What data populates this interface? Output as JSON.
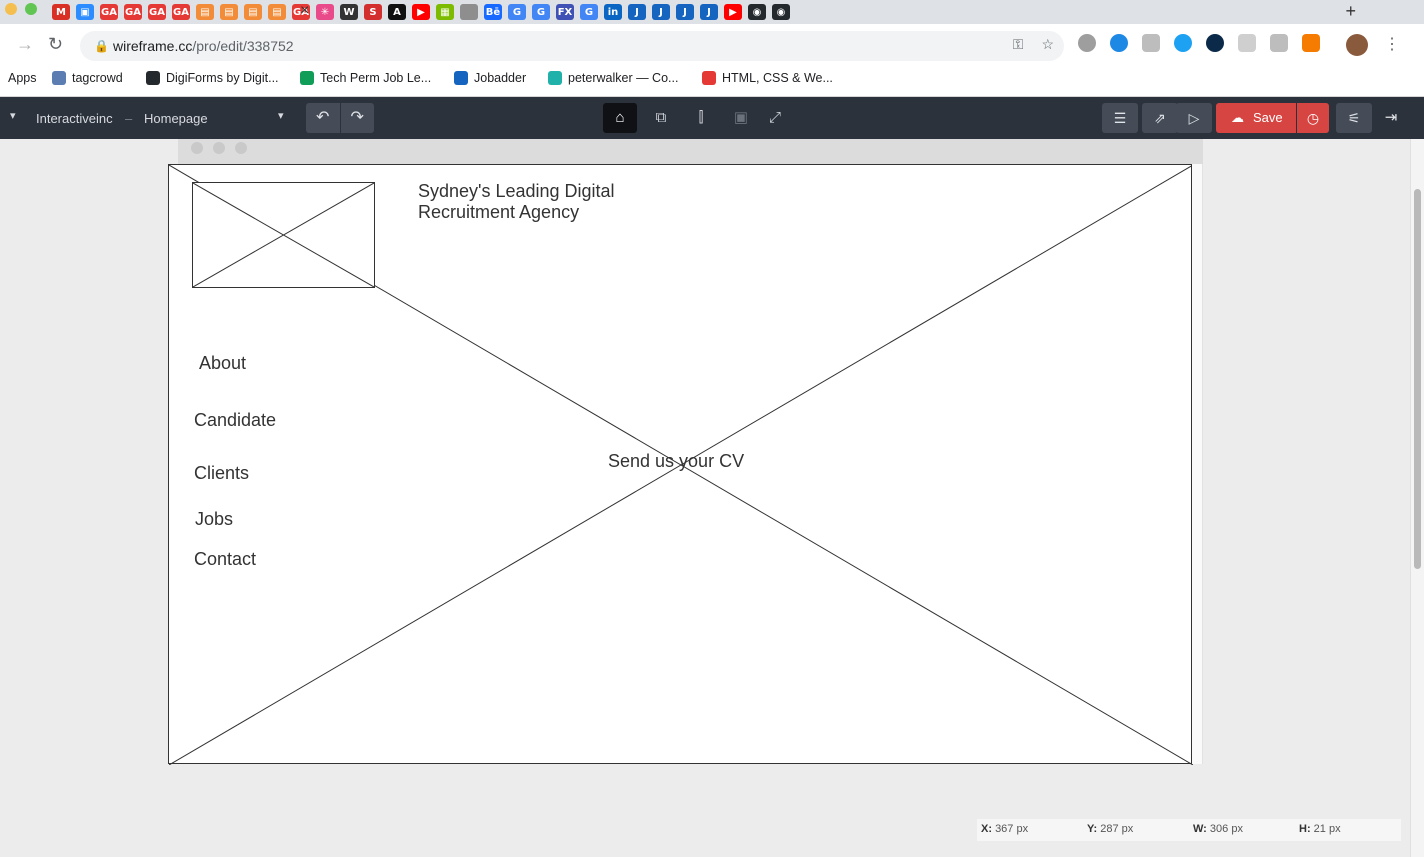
{
  "browser": {
    "url_host": "wireframe.cc",
    "url_path": "/pro/edit/338752",
    "new_tab_label": "+",
    "tab_close": "×",
    "bookmarks": [
      {
        "label": "Apps",
        "color": "#4285f4"
      },
      {
        "label": "tagcrowd",
        "color": "#5b7db1"
      },
      {
        "label": "DigiForms by Digit...",
        "color": "#24292e"
      },
      {
        "label": "Tech Perm Job Le...",
        "color": "#0f9d58"
      },
      {
        "label": "Jobadder",
        "color": "#1565c0"
      },
      {
        "label": "peterwalker — Co...",
        "color": "#20b2aa"
      },
      {
        "label": "HTML, CSS & We...",
        "color": "#e53935"
      }
    ],
    "tab_icons": [
      {
        "name": "gmail-icon",
        "text": "M",
        "color": "#d93025"
      },
      {
        "name": "zoom-icon",
        "text": "▣",
        "color": "#2d8cff"
      },
      {
        "name": "ga-icon",
        "text": "GA",
        "color": "#e53935"
      },
      {
        "name": "ga-icon",
        "text": "GA",
        "color": "#e53935"
      },
      {
        "name": "ga-icon",
        "text": "GA",
        "color": "#e53935"
      },
      {
        "name": "ga-icon",
        "text": "GA",
        "color": "#e53935"
      },
      {
        "name": "calendar-icon",
        "text": "▤",
        "color": "#f28c38"
      },
      {
        "name": "calendar-icon",
        "text": "▤",
        "color": "#f28c38"
      },
      {
        "name": "calendar-icon",
        "text": "▤",
        "color": "#f28c38"
      },
      {
        "name": "calendar-icon",
        "text": "▤",
        "color": "#f28c38"
      },
      {
        "name": "ga-icon",
        "text": "GA",
        "color": "#e53935"
      },
      {
        "name": "spinner-icon",
        "text": "✳",
        "color": "#e94b8a"
      },
      {
        "name": "w-icon",
        "text": "W",
        "color": "#333333"
      },
      {
        "name": "s-icon",
        "text": "S",
        "color": "#d32f2f"
      },
      {
        "name": "a-icon",
        "text": "A",
        "color": "#111111"
      },
      {
        "name": "youtube-icon",
        "text": "▶",
        "color": "#ff0000"
      },
      {
        "name": "microsoft-icon",
        "text": "▦",
        "color": "#7cbb00"
      },
      {
        "name": "apple-icon",
        "text": "",
        "color": "#8e8e8e"
      },
      {
        "name": "behance-icon",
        "text": "Bē",
        "color": "#1769ff"
      },
      {
        "name": "google-icon",
        "text": "G",
        "color": "#4285f4"
      },
      {
        "name": "google-icon",
        "text": "G",
        "color": "#4285f4"
      },
      {
        "name": "fx-icon",
        "text": "FX",
        "color": "#3f51b5"
      },
      {
        "name": "google-icon",
        "text": "G",
        "color": "#4285f4"
      },
      {
        "name": "linkedin-icon",
        "text": "in",
        "color": "#0a66c2"
      },
      {
        "name": "jobadder-icon",
        "text": "J",
        "color": "#1565c0"
      },
      {
        "name": "jobadder-icon",
        "text": "J",
        "color": "#1565c0"
      },
      {
        "name": "jobadder-icon",
        "text": "J",
        "color": "#1565c0"
      },
      {
        "name": "jobadder-icon",
        "text": "J",
        "color": "#1565c0"
      },
      {
        "name": "youtube-icon",
        "text": "▶",
        "color": "#ff0000"
      },
      {
        "name": "github-icon",
        "text": "◉",
        "color": "#24292e"
      },
      {
        "name": "github-icon",
        "text": "◉",
        "color": "#24292e"
      }
    ]
  },
  "app": {
    "project": "Interactiveinc",
    "separator": "–",
    "page": "Homepage",
    "save_label": "Save",
    "accent": "#d64541",
    "toolbar_bg": "#2c323c"
  },
  "wireframe": {
    "heading": "Sydney's Leading Digital Recruitment Agency",
    "nav": [
      "About",
      "Candidate",
      "Clients",
      "Jobs",
      "Contact"
    ],
    "cta": "Send us your CV"
  },
  "status": {
    "x_label": "X:",
    "x_value": "367 px",
    "y_label": "Y:",
    "y_value": "287 px",
    "w_label": "W:",
    "w_value": "306 px",
    "h_label": "H:",
    "h_value": "21 px"
  }
}
